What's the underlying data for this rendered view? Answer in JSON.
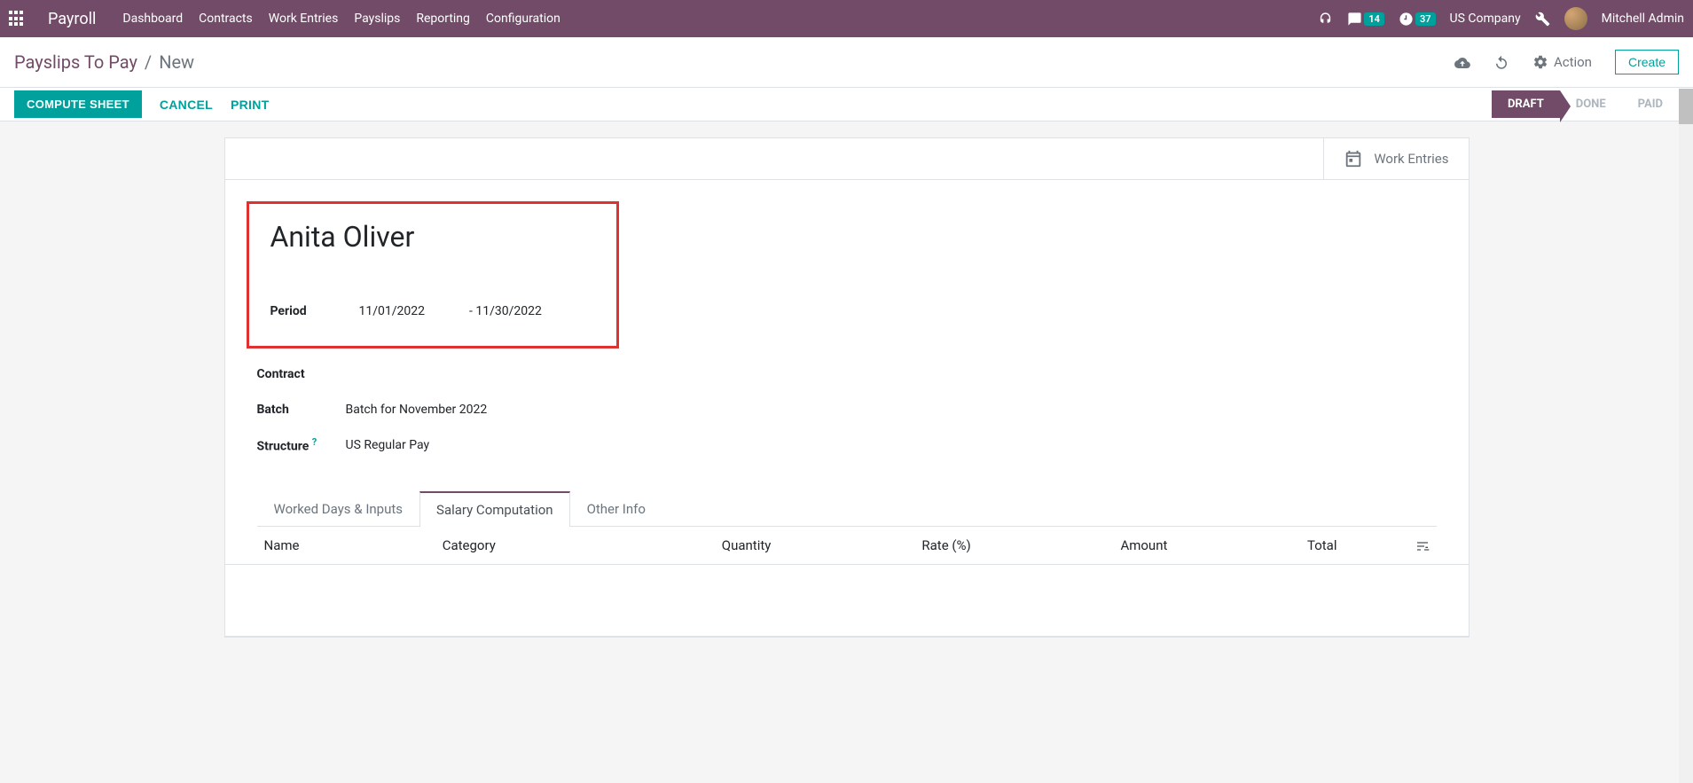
{
  "nav": {
    "app_name": "Payroll",
    "items": [
      "Dashboard",
      "Contracts",
      "Work Entries",
      "Payslips",
      "Reporting",
      "Configuration"
    ],
    "messages_badge": "14",
    "activities_badge": "37",
    "company": "US Company",
    "user": "Mitchell Admin"
  },
  "breadcrumb": {
    "parent": "Payslips To Pay",
    "current": "New"
  },
  "control": {
    "action_label": "Action",
    "create_label": "Create"
  },
  "statusbar": {
    "compute": "COMPUTE SHEET",
    "cancel": "CANCEL",
    "print": "PRINT",
    "states": [
      "DRAFT",
      "DONE",
      "PAID"
    ],
    "active_state": "DRAFT"
  },
  "sheet": {
    "stat_button": "Work Entries",
    "employee": "Anita Oliver",
    "fields": {
      "period_label": "Period",
      "period_from": "11/01/2022",
      "period_to_prefix": "- ",
      "period_to": "11/30/2022",
      "contract_label": "Contract",
      "contract_value": "",
      "batch_label": "Batch",
      "batch_value": "Batch for November 2022",
      "structure_label": "Structure",
      "structure_help": "?",
      "structure_value": "US Regular Pay"
    }
  },
  "tabs": {
    "items": [
      "Worked Days & Inputs",
      "Salary Computation",
      "Other Info"
    ],
    "active": "Salary Computation"
  },
  "table": {
    "columns": {
      "name": "Name",
      "category": "Category",
      "quantity": "Quantity",
      "rate": "Rate (%)",
      "amount": "Amount",
      "total": "Total"
    }
  }
}
